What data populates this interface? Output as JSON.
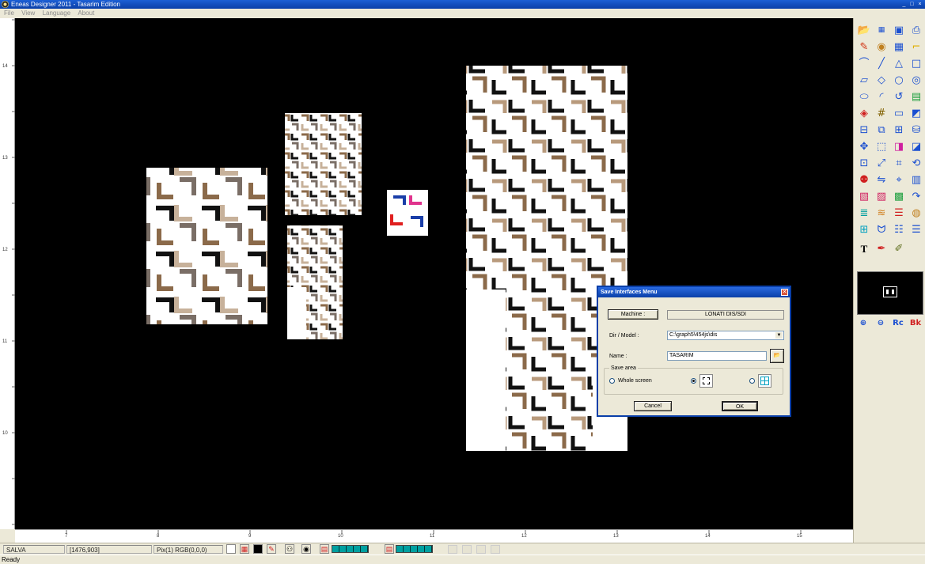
{
  "window": {
    "title": "Eneas Designer 2011 - Tasarim Edition",
    "controls": [
      "_",
      "□",
      "×"
    ]
  },
  "menu": [
    "File",
    "View",
    "Language",
    "About"
  ],
  "rulers": {
    "left": [
      "14",
      "13",
      "12",
      "11",
      "10"
    ],
    "bottom": [
      "7",
      "8",
      "9",
      "10",
      "11",
      "12",
      "13",
      "14",
      "15"
    ]
  },
  "tools": [
    "open-folder-icon",
    "pic-icon",
    "save-disk-icon",
    "printer-icon",
    "pencil-icon",
    "palette-icon",
    "grid-icon",
    "corner-icon",
    "curve-icon",
    "line-icon",
    "triangle-icon",
    "rectangle-icon",
    "parallelogram-icon",
    "diamond-icon",
    "circle-icon",
    "rings-icon",
    "ellipse-icon",
    "arc-icon",
    "lasso-icon",
    "layers-icon",
    "paint-bucket-icon",
    "hash-icon",
    "rectangle-fill-icon",
    "gradient-icon",
    "select-rect-icon",
    "copy-icon",
    "duplicate-icon",
    "fill-bucket-icon",
    "move-icon",
    "transform-icon",
    "color-swap-icon",
    "crop-icon",
    "resize-icon",
    "scale-icon",
    "crop-tool-icon",
    "rotate-icon",
    "mirror-icon",
    "flip-icon",
    "node-icon",
    "split-icon",
    "color-map-icon",
    "color-replace-icon",
    "color-blend-icon",
    "redo-curve-icon",
    "striped-icon",
    "wave-icon",
    "bars-icon",
    "palette-round-icon",
    "window-grid-icon",
    "cat-icon",
    "stripes-icon",
    "stripes-alt-icon",
    "text-icon",
    "paint-pen-icon",
    "eraser-pen-icon"
  ],
  "navigator": [
    "zoom-in-icon",
    "zoom-out-icon",
    "reset-icon",
    "back-icon"
  ],
  "navigator_labels": [
    "Rc",
    "Bk"
  ],
  "status": {
    "name": "SALVA",
    "coords": "[1476,903]",
    "pixel": "Pix(1) RGB(0,0,0)",
    "ready": "Ready"
  },
  "dialog": {
    "title": "Save Interfaces Menu",
    "machine_button": "Machine :",
    "machine_value": "LONATI DIS/SDI",
    "dir_label": "Dir / Model :",
    "dir_value": "C:\\graph5\\454js\\dis",
    "name_label": "Name :",
    "name_value": "TASARIM",
    "save_area_label": "Save area",
    "whole_screen": "Whole screen",
    "cancel": "Cancel",
    "ok": "OK"
  },
  "colors": {
    "titlebar": "#0a3fa8",
    "canvas": "#000000",
    "chart_brown": "#8b6a4a",
    "light_brown": "#c8b39a",
    "teal": "#00a0a0"
  }
}
